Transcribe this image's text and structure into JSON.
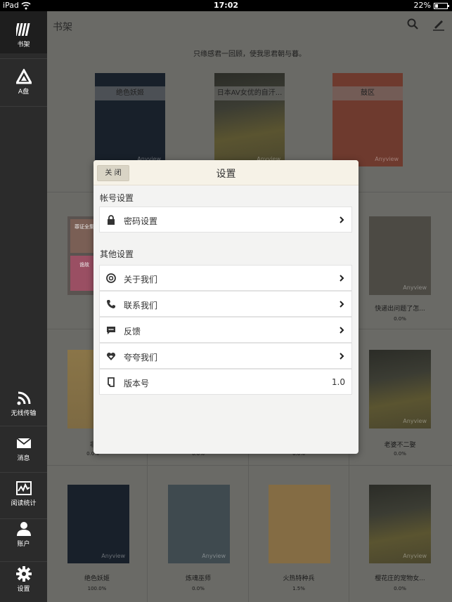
{
  "statusbar": {
    "carrier": "iPad",
    "time": "17:02",
    "battery": "22%"
  },
  "sidebar": {
    "items": [
      {
        "label": "书架",
        "icon": "bookshelf-icon"
      },
      {
        "label": "A盘",
        "icon": "a-disk-icon"
      },
      {
        "label": "无线传输",
        "icon": "wifi-transfer-icon"
      },
      {
        "label": "消息",
        "icon": "mail-icon"
      },
      {
        "label": "阅读统计",
        "icon": "chart-icon"
      },
      {
        "label": "账户",
        "icon": "user-icon"
      },
      {
        "label": "设置",
        "icon": "gear-icon"
      }
    ]
  },
  "topbar": {
    "title": "书架"
  },
  "shelf": {
    "quote": "只缘感君一回顾，使我思君朝与暮。",
    "featured": [
      {
        "title": "绝色妖姬"
      },
      {
        "title": "日本AV女优的自汗..."
      },
      {
        "title": "鼓区"
      }
    ],
    "row2": [
      {
        "cover_texts": [
          "罪证全集",
          "诡故"
        ],
        "title": "",
        "pct": ""
      },
      {
        "title": "快递出问题了怎...",
        "pct": "0.0%"
      }
    ],
    "row3": [
      {
        "title": "非",
        "pct": "0.0%"
      },
      {
        "title": "",
        "pct": "0.0%"
      },
      {
        "title": "",
        "pct": "0.0%"
      },
      {
        "title": "老婆不二娶",
        "pct": "0.0%"
      }
    ],
    "row4": [
      {
        "title": "绝色妖姬",
        "pct": "100.0%"
      },
      {
        "title": "炼魂巫师",
        "pct": "0.0%"
      },
      {
        "title": "火热特种兵",
        "pct": "1.5%"
      },
      {
        "title": "樱花庄的宠物女...",
        "pct": "0.0%"
      }
    ],
    "brand": "Anyview"
  },
  "modal": {
    "close_label": "关 闭",
    "title": "设置",
    "account_section": "帐号设置",
    "account_items": [
      {
        "label": "密码设置",
        "icon": "lock-icon"
      }
    ],
    "other_section": "其他设置",
    "other_items": [
      {
        "label": "关于我们",
        "icon": "about-icon"
      },
      {
        "label": "联系我们",
        "icon": "phone-icon"
      },
      {
        "label": "反馈",
        "icon": "chat-icon"
      },
      {
        "label": "夸夸我们",
        "icon": "heart-icon"
      },
      {
        "label": "版本号",
        "icon": "receipt-icon",
        "value": "1.0"
      }
    ]
  }
}
